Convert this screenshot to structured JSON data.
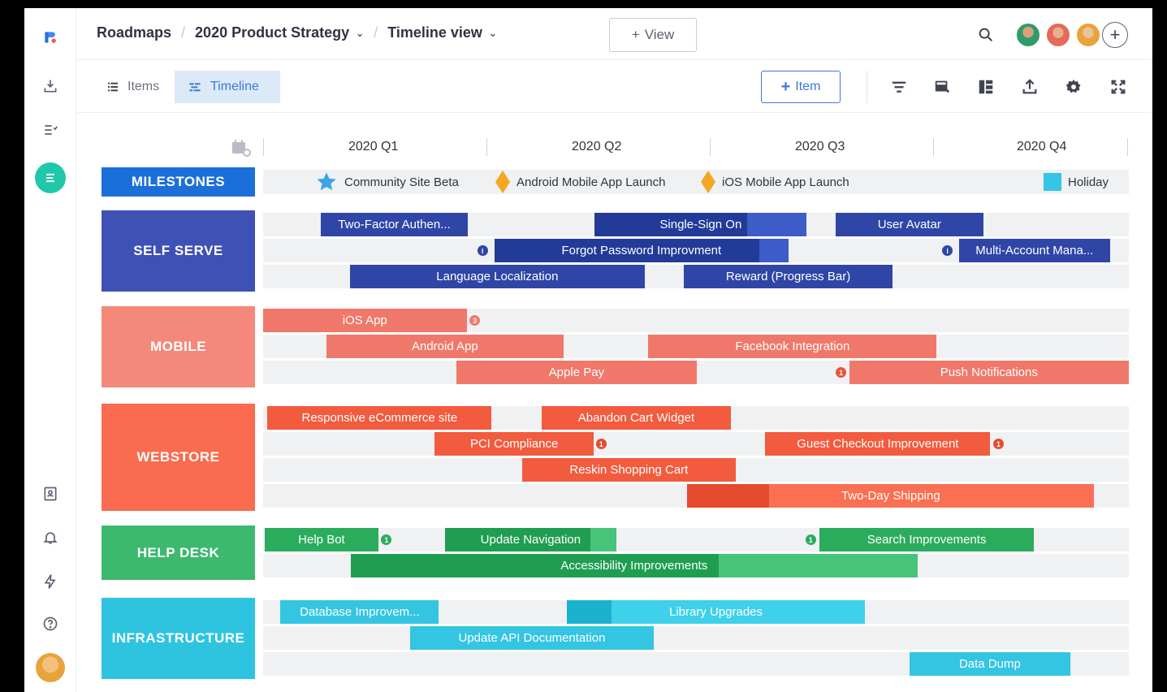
{
  "breadcrumb": {
    "root": "Roadmaps",
    "roadmap": "2020 Product Strategy",
    "view": "Timeline view"
  },
  "topbar": {
    "add_view_label": "View"
  },
  "toolbar": {
    "tab_items": "Items",
    "tab_timeline": "Timeline",
    "add_item_label": "Item"
  },
  "quarters": [
    "2020 Q1",
    "2020 Q2",
    "2020 Q3",
    "2020 Q4"
  ],
  "milestones": {
    "label": "MILESTONES",
    "items": [
      "Community Site Beta",
      "Android Mobile App Launch",
      "iOS Mobile App Launch",
      "Holiday"
    ]
  },
  "groups": [
    {
      "label": "SELF SERVE",
      "color": "#3f51b5",
      "bar_color": "#2f46a6",
      "progress_color": "#223a98",
      "bars": [
        {
          "label": "Two-Factor Authen...",
          "start": 0.067,
          "end": 0.236,
          "row": 0
        },
        {
          "label": "Single-Sign On",
          "start": 0.383,
          "end": 0.628,
          "row": 0,
          "progress": 0.72
        },
        {
          "label": "User Avatar",
          "start": 0.661,
          "end": 0.832,
          "row": 0
        },
        {
          "label": "Forgot Password Improvment",
          "start": 0.267,
          "end": 0.607,
          "row": 1,
          "progress": 0.9
        },
        {
          "label": "Multi-Account Mana...",
          "start": 0.804,
          "end": 0.978,
          "row": 1
        },
        {
          "label": "Language Localization",
          "start": 0.1,
          "end": 0.441,
          "row": 2
        },
        {
          "label": "Reward (Progress Bar)",
          "start": 0.486,
          "end": 0.727,
          "row": 2
        }
      ]
    },
    {
      "label": "MOBILE",
      "color": "#f4887a",
      "bar_color": "#f0786a",
      "progress_color": "#ec6a5b",
      "bars": [
        {
          "label": "iOS App",
          "start": 0.0,
          "end": 0.235,
          "row": 0
        },
        {
          "label": "Android App",
          "start": 0.073,
          "end": 0.347,
          "row": 1
        },
        {
          "label": "Facebook Integration",
          "start": 0.445,
          "end": 0.778,
          "row": 1
        },
        {
          "label": "Apple Pay",
          "start": 0.223,
          "end": 0.501,
          "row": 2
        },
        {
          "label": "Push Notifications",
          "start": 0.677,
          "end": 1.0,
          "row": 2
        }
      ]
    },
    {
      "label": "WEBSTORE",
      "color": "#fa6b4f",
      "bar_color": "#f25b3e",
      "progress_color": "#e54b2e",
      "bars": [
        {
          "label": "Responsive eCommerce site",
          "start": 0.005,
          "end": 0.264,
          "row": 0
        },
        {
          "label": "Abandon Cart Widget",
          "start": 0.322,
          "end": 0.54,
          "row": 0
        },
        {
          "label": "PCI Compliance",
          "start": 0.198,
          "end": 0.382,
          "row": 1
        },
        {
          "label": "Guest Checkout Improvement",
          "start": 0.58,
          "end": 0.84,
          "row": 1
        },
        {
          "label": "Reskin Shopping Cart",
          "start": 0.299,
          "end": 0.546,
          "row": 2
        },
        {
          "label": "Two-Day Shipping",
          "start": 0.49,
          "end": 0.96,
          "row": 3,
          "progress": 0.2
        }
      ]
    },
    {
      "label": "HELP DESK",
      "color": "#3cb96e",
      "bar_color": "#2aac5d",
      "progress_color": "#1f9e51",
      "bars": [
        {
          "label": "Help Bot",
          "start": 0.002,
          "end": 0.133,
          "row": 0
        },
        {
          "label": "Update Navigation",
          "start": 0.21,
          "end": 0.408,
          "row": 0,
          "progress": 0.85
        },
        {
          "label": "Search Improvements",
          "start": 0.643,
          "end": 0.89,
          "row": 0
        },
        {
          "label": "Accessibility Improvements",
          "start": 0.101,
          "end": 0.756,
          "row": 1,
          "progress": 0.65
        }
      ]
    },
    {
      "label": "INFRASTRUCTURE",
      "color": "#2ec4e0",
      "bar_color": "#33c5e2",
      "progress_color": "#1ab1cf",
      "bars": [
        {
          "label": "Database Improvem...",
          "start": 0.02,
          "end": 0.203,
          "row": 0
        },
        {
          "label": "Library Upgrades",
          "start": 0.351,
          "end": 0.695,
          "row": 0,
          "progress": 0.15
        },
        {
          "label": "Update API Documentation",
          "start": 0.17,
          "end": 0.451,
          "row": 1
        },
        {
          "label": "Data Dump",
          "start": 0.747,
          "end": 0.932,
          "row": 2
        }
      ]
    }
  ],
  "colors": {
    "accent": "#3b7bd4",
    "milestones": "#1c6fd9",
    "star": "#3aa6e8",
    "diamond": "#f5a623",
    "holiday": "#35c6e6"
  }
}
